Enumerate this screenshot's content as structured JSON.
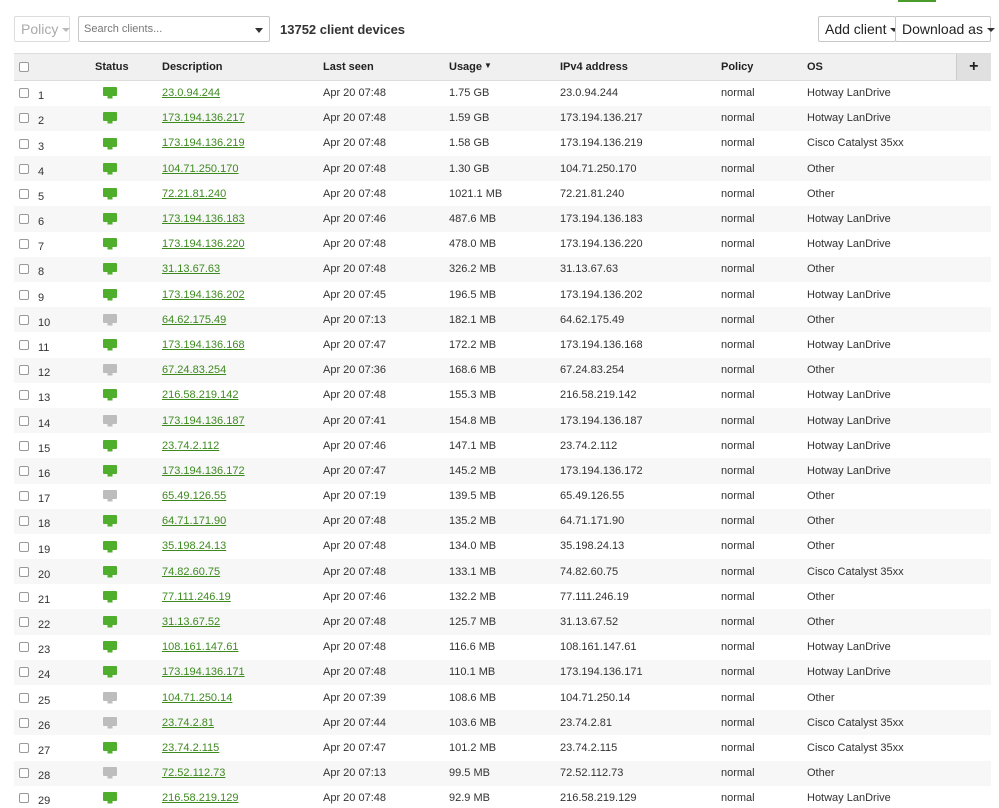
{
  "toolbar": {
    "policy_label": "Policy",
    "search_placeholder": "Search clients...",
    "client_count": "13752 client devices",
    "add_client_label": "Add client",
    "download_label": "Download as"
  },
  "columns": {
    "status": "Status",
    "description": "Description",
    "last_seen": "Last seen",
    "usage": "Usage",
    "ipv4": "IPv4 address",
    "policy": "Policy",
    "os": "OS",
    "add_column": "+"
  },
  "colors": {
    "online": "#4fae2c",
    "offline": "#bdbdbd",
    "link": "#3d8b1f"
  },
  "rows": [
    {
      "num": "1",
      "status": "online",
      "description": "23.0.94.244",
      "last_seen": "Apr 20 07:48",
      "usage": "1.75 GB",
      "ipv4": "23.0.94.244",
      "policy": "normal",
      "os": "Hotway LanDrive"
    },
    {
      "num": "2",
      "status": "online",
      "description": "173.194.136.217",
      "last_seen": "Apr 20 07:48",
      "usage": "1.59 GB",
      "ipv4": "173.194.136.217",
      "policy": "normal",
      "os": "Hotway LanDrive"
    },
    {
      "num": "3",
      "status": "online",
      "description": "173.194.136.219",
      "last_seen": "Apr 20 07:48",
      "usage": "1.58 GB",
      "ipv4": "173.194.136.219",
      "policy": "normal",
      "os": "Cisco Catalyst 35xx"
    },
    {
      "num": "4",
      "status": "online",
      "description": "104.71.250.170",
      "last_seen": "Apr 20 07:48",
      "usage": "1.30 GB",
      "ipv4": "104.71.250.170",
      "policy": "normal",
      "os": "Other"
    },
    {
      "num": "5",
      "status": "online",
      "description": "72.21.81.240",
      "last_seen": "Apr 20 07:48",
      "usage": "1021.1 MB",
      "ipv4": "72.21.81.240",
      "policy": "normal",
      "os": "Other"
    },
    {
      "num": "6",
      "status": "online",
      "description": "173.194.136.183",
      "last_seen": "Apr 20 07:46",
      "usage": "487.6 MB",
      "ipv4": "173.194.136.183",
      "policy": "normal",
      "os": "Hotway LanDrive"
    },
    {
      "num": "7",
      "status": "online",
      "description": "173.194.136.220",
      "last_seen": "Apr 20 07:48",
      "usage": "478.0 MB",
      "ipv4": "173.194.136.220",
      "policy": "normal",
      "os": "Hotway LanDrive"
    },
    {
      "num": "8",
      "status": "online",
      "description": "31.13.67.63",
      "last_seen": "Apr 20 07:48",
      "usage": "326.2 MB",
      "ipv4": "31.13.67.63",
      "policy": "normal",
      "os": "Other"
    },
    {
      "num": "9",
      "status": "online",
      "description": "173.194.136.202",
      "last_seen": "Apr 20 07:45",
      "usage": "196.5 MB",
      "ipv4": "173.194.136.202",
      "policy": "normal",
      "os": "Hotway LanDrive"
    },
    {
      "num": "10",
      "status": "offline",
      "description": "64.62.175.49",
      "last_seen": "Apr 20 07:13",
      "usage": "182.1 MB",
      "ipv4": "64.62.175.49",
      "policy": "normal",
      "os": "Other"
    },
    {
      "num": "11",
      "status": "online",
      "description": "173.194.136.168",
      "last_seen": "Apr 20 07:47",
      "usage": "172.2 MB",
      "ipv4": "173.194.136.168",
      "policy": "normal",
      "os": "Hotway LanDrive"
    },
    {
      "num": "12",
      "status": "offline",
      "description": "67.24.83.254",
      "last_seen": "Apr 20 07:36",
      "usage": "168.6 MB",
      "ipv4": "67.24.83.254",
      "policy": "normal",
      "os": "Other"
    },
    {
      "num": "13",
      "status": "online",
      "description": "216.58.219.142",
      "last_seen": "Apr 20 07:48",
      "usage": "155.3 MB",
      "ipv4": "216.58.219.142",
      "policy": "normal",
      "os": "Hotway LanDrive"
    },
    {
      "num": "14",
      "status": "offline",
      "description": "173.194.136.187",
      "last_seen": "Apr 20 07:41",
      "usage": "154.8 MB",
      "ipv4": "173.194.136.187",
      "policy": "normal",
      "os": "Hotway LanDrive"
    },
    {
      "num": "15",
      "status": "online",
      "description": "23.74.2.112",
      "last_seen": "Apr 20 07:46",
      "usage": "147.1 MB",
      "ipv4": "23.74.2.112",
      "policy": "normal",
      "os": "Hotway LanDrive"
    },
    {
      "num": "16",
      "status": "online",
      "description": "173.194.136.172",
      "last_seen": "Apr 20 07:47",
      "usage": "145.2 MB",
      "ipv4": "173.194.136.172",
      "policy": "normal",
      "os": "Hotway LanDrive"
    },
    {
      "num": "17",
      "status": "offline",
      "description": "65.49.126.55",
      "last_seen": "Apr 20 07:19",
      "usage": "139.5 MB",
      "ipv4": "65.49.126.55",
      "policy": "normal",
      "os": "Other"
    },
    {
      "num": "18",
      "status": "online",
      "description": "64.71.171.90",
      "last_seen": "Apr 20 07:48",
      "usage": "135.2 MB",
      "ipv4": "64.71.171.90",
      "policy": "normal",
      "os": "Other"
    },
    {
      "num": "19",
      "status": "online",
      "description": "35.198.24.13",
      "last_seen": "Apr 20 07:48",
      "usage": "134.0 MB",
      "ipv4": "35.198.24.13",
      "policy": "normal",
      "os": "Other"
    },
    {
      "num": "20",
      "status": "online",
      "description": "74.82.60.75",
      "last_seen": "Apr 20 07:48",
      "usage": "133.1 MB",
      "ipv4": "74.82.60.75",
      "policy": "normal",
      "os": "Cisco Catalyst 35xx"
    },
    {
      "num": "21",
      "status": "online",
      "description": "77.111.246.19",
      "last_seen": "Apr 20 07:46",
      "usage": "132.2 MB",
      "ipv4": "77.111.246.19",
      "policy": "normal",
      "os": "Other"
    },
    {
      "num": "22",
      "status": "online",
      "description": "31.13.67.52",
      "last_seen": "Apr 20 07:48",
      "usage": "125.7 MB",
      "ipv4": "31.13.67.52",
      "policy": "normal",
      "os": "Other"
    },
    {
      "num": "23",
      "status": "online",
      "description": "108.161.147.61",
      "last_seen": "Apr 20 07:48",
      "usage": "116.6 MB",
      "ipv4": "108.161.147.61",
      "policy": "normal",
      "os": "Hotway LanDrive"
    },
    {
      "num": "24",
      "status": "online",
      "description": "173.194.136.171",
      "last_seen": "Apr 20 07:48",
      "usage": "110.1 MB",
      "ipv4": "173.194.136.171",
      "policy": "normal",
      "os": "Hotway LanDrive"
    },
    {
      "num": "25",
      "status": "offline",
      "description": "104.71.250.14",
      "last_seen": "Apr 20 07:39",
      "usage": "108.6 MB",
      "ipv4": "104.71.250.14",
      "policy": "normal",
      "os": "Other"
    },
    {
      "num": "26",
      "status": "offline",
      "description": "23.74.2.81",
      "last_seen": "Apr 20 07:44",
      "usage": "103.6 MB",
      "ipv4": "23.74.2.81",
      "policy": "normal",
      "os": "Cisco Catalyst 35xx"
    },
    {
      "num": "27",
      "status": "online",
      "description": "23.74.2.115",
      "last_seen": "Apr 20 07:47",
      "usage": "101.2 MB",
      "ipv4": "23.74.2.115",
      "policy": "normal",
      "os": "Cisco Catalyst 35xx"
    },
    {
      "num": "28",
      "status": "offline",
      "description": "72.52.112.73",
      "last_seen": "Apr 20 07:13",
      "usage": "99.5 MB",
      "ipv4": "72.52.112.73",
      "policy": "normal",
      "os": "Other"
    },
    {
      "num": "29",
      "status": "online",
      "description": "216.58.219.129",
      "last_seen": "Apr 20 07:48",
      "usage": "92.9 MB",
      "ipv4": "216.58.219.129",
      "policy": "normal",
      "os": "Hotway LanDrive"
    }
  ]
}
